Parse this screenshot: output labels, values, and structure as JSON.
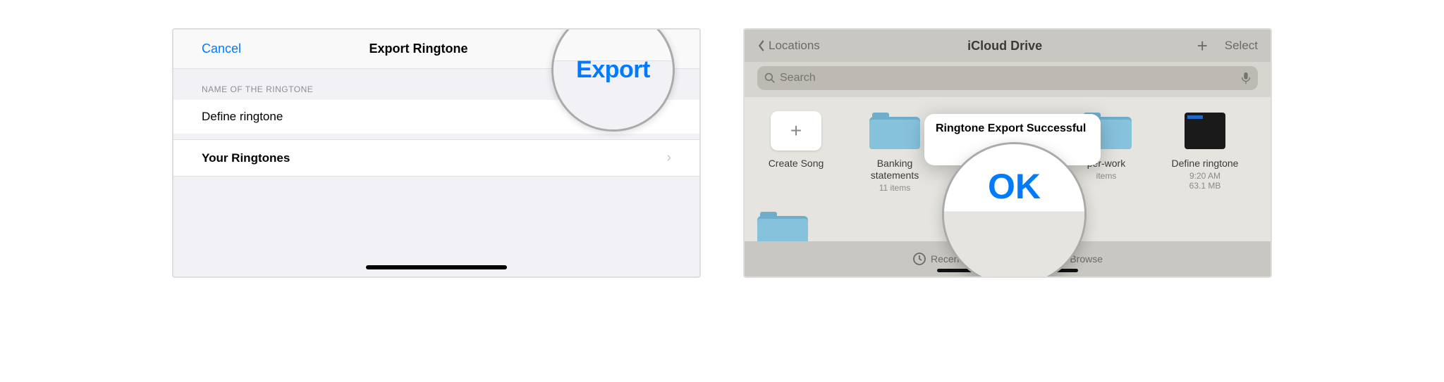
{
  "left": {
    "nav": {
      "cancel": "Cancel",
      "title": "Export Ringtone",
      "export": "Export"
    },
    "section_label": "NAME OF THE RINGTONE",
    "name_value": "Define ringtone",
    "ringtones_row": "Your Ringtones"
  },
  "right": {
    "nav": {
      "back": "Locations",
      "title": "iCloud Drive",
      "select": "Select"
    },
    "search": {
      "placeholder": "Search"
    },
    "items": {
      "create": {
        "label": "Create Song"
      },
      "bank": {
        "label": "Banking statements",
        "meta": "11 items"
      },
      "paper": {
        "label": "per-work",
        "meta": "items"
      },
      "define": {
        "label": "Define ringtone",
        "time": "9:20 AM",
        "size": "63.1 MB"
      }
    },
    "popover": {
      "title": "Ringtone Export Successful",
      "ok": "OK"
    },
    "tabs": {
      "recents": "Recents",
      "browse": "Browse"
    }
  }
}
